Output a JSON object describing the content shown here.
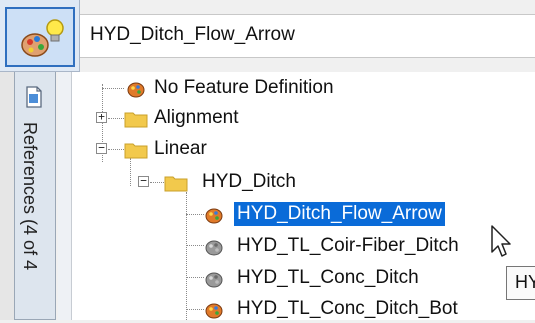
{
  "toolbar": {
    "feature_button_icon": "feature-lightbulb-icon",
    "current_feature": "HYD_Ditch_Flow_Arrow"
  },
  "side_tab": {
    "icon": "document-icon",
    "label": "References (4 of 4"
  },
  "tree": {
    "items": [
      {
        "label": "No Feature Definition",
        "icon": "feature-palette-icon"
      },
      {
        "label": "Alignment",
        "icon": "folder-icon",
        "expander": "+"
      },
      {
        "label": "Linear",
        "icon": "folder-icon",
        "expander": "−"
      },
      {
        "label": "HYD_Ditch",
        "icon": "folder-icon",
        "expander": "−"
      },
      {
        "label": "HYD_Ditch_Flow_Arrow",
        "icon": "feature-palette-icon",
        "selected": true
      },
      {
        "label": "HYD_TL_Coir-Fiber_Ditch",
        "icon": "feature-palette-grey-icon"
      },
      {
        "label": "HYD_TL_Conc_Ditch",
        "icon": "feature-palette-grey-icon"
      },
      {
        "label": "HYD_TL_Conc_Ditch_Bot",
        "icon": "feature-palette-icon"
      }
    ]
  },
  "tooltip": {
    "text": "HY"
  },
  "colors": {
    "selection": "#0a6bd8",
    "folder": "#f2c94c",
    "palette": "#e07a2a"
  }
}
